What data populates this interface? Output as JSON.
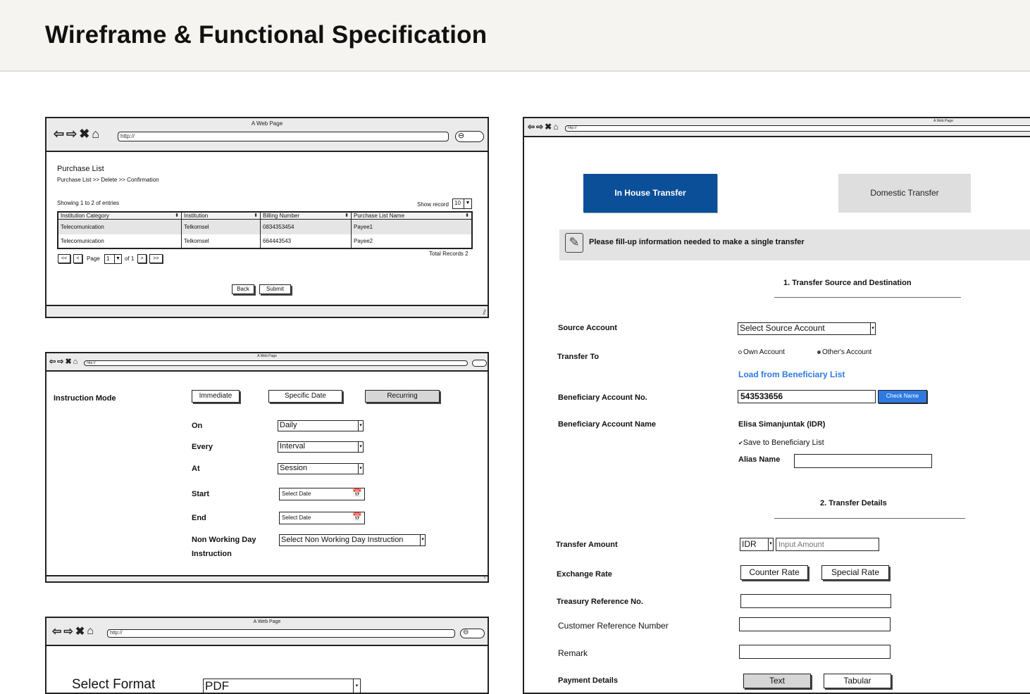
{
  "header": {
    "title": "Wireframe & Functional Specification"
  },
  "browser": {
    "page_title": "A Web Page",
    "url": "http://"
  },
  "purchase_list": {
    "title": "Purchase List",
    "breadcrumb": "Purchase List >> Delete >> Confirmation",
    "showing": "Showing 1 to 2 of entries",
    "show_record_label": "Show record",
    "show_record_value": "10",
    "columns": [
      "Institution  Category",
      "Institution",
      "Billing Number",
      "Purchase List Name"
    ],
    "rows": [
      [
        "Telecomunication",
        "Telkomsel",
        "0834353454",
        "Payee1"
      ],
      [
        "Telecomunication",
        "Telkomsel",
        "664443543",
        "Payee2"
      ]
    ],
    "pager": {
      "first": "<<",
      "prev": "<",
      "page_label": "Page",
      "page_value": "1",
      "of_label": "of 1",
      "next": ">",
      "last": ">>"
    },
    "total_records": "Total Records 2",
    "back": "Back",
    "submit": "Submit"
  },
  "instruction": {
    "mode_label": "Instruction Mode",
    "modes": [
      "Immediate",
      "Specific Date",
      "Recurring"
    ],
    "on_label": "On",
    "on_value": "Daily",
    "every_label": "Every",
    "every_value": "Interval",
    "at_label": "At",
    "at_value": "Session",
    "start_label": "Start",
    "start_value": "Select Date",
    "end_label": "End",
    "end_value": "Select Date",
    "nwd_label_1": "Non Working Day",
    "nwd_label_2": "Instruction",
    "nwd_value": "Select Non Working Day Instruction"
  },
  "format": {
    "label": "Select Format",
    "value": "PDF"
  },
  "transfer": {
    "tab_inhouse": "In House Transfer",
    "tab_domestic": "Domestic Transfer",
    "notice": "Please fill-up information needed to make a single transfer",
    "section1": "1. Transfer Source and Destination",
    "source_label": "Source Account",
    "source_value": "Select Source Account",
    "transfer_to_label": "Transfer To",
    "own_account": "Own Account",
    "others_account": "Other's Account",
    "load_beneficiary": "Load from Beneficiary List",
    "benef_no_label": "Beneficiary Account No.",
    "benef_no_value": "543533656",
    "check_name": "Check Name",
    "benef_name_label": "Beneficiary Account Name",
    "benef_name_value": "Elisa Simanjuntak (IDR)",
    "save_benef": "Save to Beneficiary List",
    "alias_label": "Alias Name",
    "section2": "2. Transfer Details",
    "amount_label": "Transfer Amount",
    "currency": "IDR",
    "amount_placeholder": "Input Amount",
    "exchange_label": "Exchange Rate",
    "counter_rate": "Counter Rate",
    "special_rate": "Special Rate",
    "treasury_label": "Treasury Reference No.",
    "customer_ref_label": "Customer Reference Number",
    "remark_label": "Remark",
    "payment_details_label": "Payment Details",
    "text_btn": "Text",
    "tabular_btn": "Tabular"
  }
}
